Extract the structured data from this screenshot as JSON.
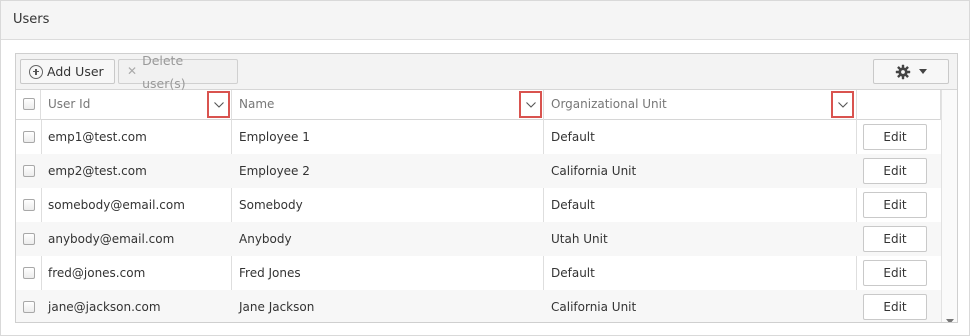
{
  "panel": {
    "title": "Users"
  },
  "toolbar": {
    "add_label": "Add User",
    "delete_label": "Delete user(s)",
    "settings_icon": "gear-icon"
  },
  "columns": [
    {
      "label": "User Id"
    },
    {
      "label": "Name"
    },
    {
      "label": "Organizational Unit"
    }
  ],
  "rows": [
    {
      "user_id": "emp1@test.com",
      "name": "Employee 1",
      "unit": "Default",
      "action": "Edit"
    },
    {
      "user_id": "emp2@test.com",
      "name": "Employee 2",
      "unit": "California Unit",
      "action": "Edit"
    },
    {
      "user_id": "somebody@email.com",
      "name": "Somebody",
      "unit": "Default",
      "action": "Edit"
    },
    {
      "user_id": "anybody@email.com",
      "name": "Anybody",
      "unit": "Utah Unit",
      "action": "Edit"
    },
    {
      "user_id": "fred@jones.com",
      "name": "Fred Jones",
      "unit": "Default",
      "action": "Edit"
    },
    {
      "user_id": "jane@jackson.com",
      "name": "Jane Jackson",
      "unit": "California Unit",
      "action": "Edit"
    }
  ],
  "colors": {
    "sort_highlight": "#d9534f",
    "alt_row": "#f7f7f7"
  }
}
